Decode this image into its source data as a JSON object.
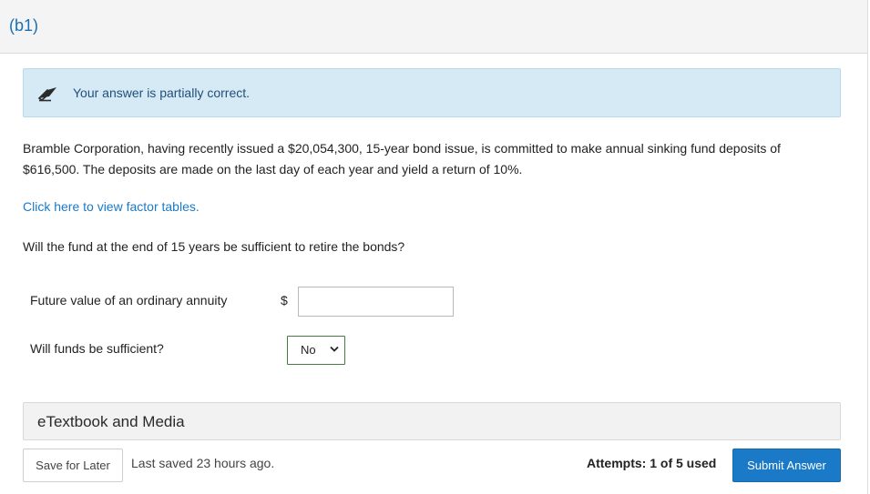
{
  "header": {
    "part_label": "(b1)"
  },
  "feedback": {
    "icon": "pencil-eraser-icon",
    "message": "Your answer is partially correct."
  },
  "problem": {
    "text": "Bramble Corporation, having recently issued a $20,054,300, 15-year bond issue, is committed to make annual sinking fund deposits of $616,500. The deposits are made on the last day of each year and yield a return of 10%.",
    "factor_link": "Click here to view factor tables.",
    "question": "Will the fund at the end of 15 years be sufficient to retire the bonds?"
  },
  "fields": {
    "fv_label": "Future value of an ordinary annuity",
    "fv_currency": "$",
    "fv_value": "",
    "sufficient_label": "Will funds be sufficient?",
    "sufficient_selected": "No"
  },
  "etextbook": {
    "label": "eTextbook and Media"
  },
  "footer": {
    "save_label": "Save for Later",
    "last_saved": "Last saved 23 hours ago.",
    "attempts": "Attempts: 1 of 5 used",
    "submit_label": "Submit Answer"
  },
  "colors": {
    "link": "#1a7ac8",
    "feedback_bg": "#d6eaf6",
    "select_border": "#4a7a44"
  }
}
